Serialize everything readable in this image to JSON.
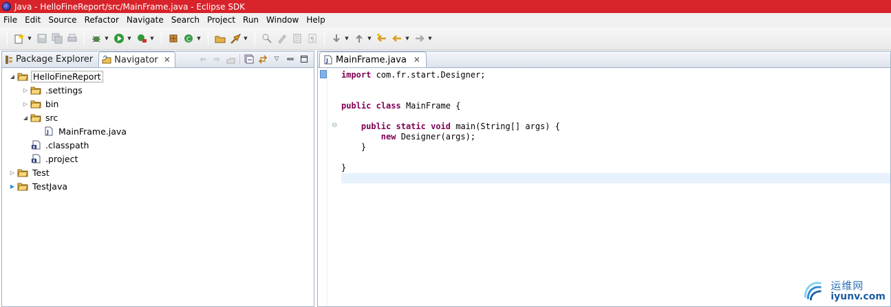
{
  "window": {
    "title": "Java - HelloFineReport/src/MainFrame.java - Eclipse SDK"
  },
  "menu": [
    "File",
    "Edit",
    "Source",
    "Refactor",
    "Navigate",
    "Search",
    "Project",
    "Run",
    "Window",
    "Help"
  ],
  "left_view": {
    "tabs": [
      {
        "label": "Package Explorer",
        "icon": "package-explorer-icon",
        "active": false
      },
      {
        "label": "Navigator",
        "icon": "navigator-icon",
        "active": true
      }
    ],
    "tree": [
      {
        "label": "HelloFineReport",
        "depth": 0,
        "expanded": true,
        "kind": "project",
        "selected": true
      },
      {
        "label": ".settings",
        "depth": 1,
        "expanded": false,
        "kind": "folder"
      },
      {
        "label": "bin",
        "depth": 1,
        "expanded": false,
        "kind": "folder"
      },
      {
        "label": "src",
        "depth": 1,
        "expanded": true,
        "kind": "folder"
      },
      {
        "label": "MainFrame.java",
        "depth": 2,
        "kind": "java-file"
      },
      {
        "label": ".classpath",
        "depth": 1,
        "kind": "xml-file"
      },
      {
        "label": ".project",
        "depth": 1,
        "kind": "xml-file"
      },
      {
        "label": "Test",
        "depth": 0,
        "expanded": false,
        "kind": "project"
      },
      {
        "label": "TestJava",
        "depth": 0,
        "expanded": false,
        "kind": "project"
      }
    ]
  },
  "editor": {
    "tab_label": "MainFrame.java",
    "lines": [
      [
        {
          "t": "import",
          "k": true
        },
        {
          "t": " com.fr.start.Designer;"
        }
      ],
      [],
      [],
      [
        {
          "t": "public",
          "k": true
        },
        {
          "t": " "
        },
        {
          "t": "class",
          "k": true
        },
        {
          "t": " MainFrame {"
        }
      ],
      [],
      [
        {
          "t": "    "
        },
        {
          "t": "public",
          "k": true
        },
        {
          "t": " "
        },
        {
          "t": "static",
          "k": true
        },
        {
          "t": " "
        },
        {
          "t": "void",
          "k": true
        },
        {
          "t": " main(String[] args) {"
        }
      ],
      [
        {
          "t": "        "
        },
        {
          "t": "new",
          "k": true
        },
        {
          "t": " Designer(args);"
        }
      ],
      [
        {
          "t": "    }"
        }
      ],
      [],
      [
        {
          "t": "}"
        }
      ],
      []
    ],
    "current_line": 10
  },
  "watermark": {
    "cn": "运维网",
    "en": "iyunv.com"
  }
}
